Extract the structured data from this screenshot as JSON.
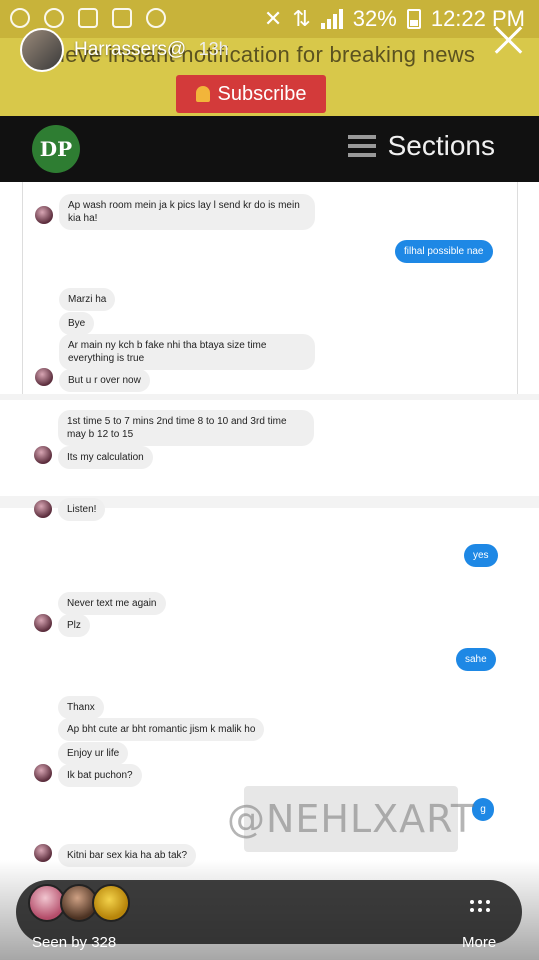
{
  "status_bar": {
    "battery": "32%",
    "time": "12:22 PM"
  },
  "story": {
    "username": "Harrassers@",
    "time_ago": "13h"
  },
  "banner": {
    "text": "ieve instant notification for breaking news",
    "subscribe_label": "Subscribe",
    "close_label": "x"
  },
  "site_header": {
    "logo_text": "DP",
    "sections_label": "Sections"
  },
  "chat": {
    "panel1": {
      "m1": "Ap wash room mein ja k pics lay l send kr do is mein kia ha!",
      "m2": "filhal possible nae",
      "m3": "Marzi ha",
      "m4": "Bye",
      "m5": "Ar main ny kch b fake nhi tha btaya size time everything is true",
      "m6": "But u r over now"
    },
    "panel2": {
      "m1": "1st time 5 to 7 mins 2nd time 8 to 10 and 3rd time may b 12 to 15",
      "m2": "Its my calculation"
    },
    "panel3": {
      "m0": "Listen!",
      "m1": "yes",
      "m2": "Never text me again",
      "m3": "Plz",
      "m4": "sahe",
      "m5": "Thanx",
      "m6": "Ap bht cute ar bht romantic jism k malik ho",
      "m7": "Enjoy ur life",
      "m8": "Ik bat puchon?",
      "m9": "g",
      "m10": "Kitni bar sex kia ha ab tak?"
    }
  },
  "watermark": "@NEHLXART",
  "footer": {
    "seen_by": "Seen by 328",
    "more_label": "More"
  }
}
